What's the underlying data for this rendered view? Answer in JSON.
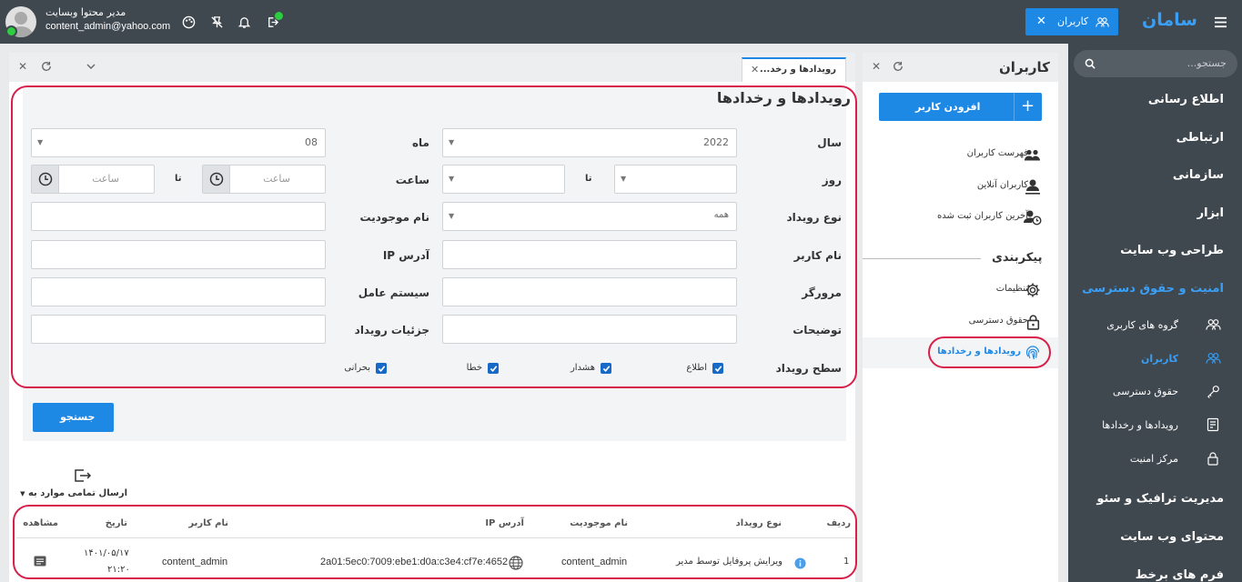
{
  "topbar": {
    "user_name": "مدیر محتوا وبسایت",
    "user_email": "content_admin@yahoo.com",
    "app_name": "سامان",
    "active_chip": "کاربران"
  },
  "sidebar": {
    "search_placeholder": "جستجو...",
    "items": [
      {
        "label": "اطلاع رسانی"
      },
      {
        "label": "ارتباطی"
      },
      {
        "label": "سازمانی"
      },
      {
        "label": "ابزار"
      },
      {
        "label": "طراحی وب سایت"
      },
      {
        "label": "امنیت و حقوق دسترسی"
      },
      {
        "label": "مدیریت ترافیک و سئو"
      },
      {
        "label": "محتوای وب سایت"
      },
      {
        "label": "فرم های برخط"
      }
    ],
    "sub_items": [
      {
        "label": "گروه های کاربری",
        "icon": "users-group-icon"
      },
      {
        "label": "کاربران",
        "icon": "users-icon"
      },
      {
        "label": "حقوق دسترسی",
        "icon": "key-icon"
      },
      {
        "label": "رویدادها و رخدادها",
        "icon": "event-list-icon"
      },
      {
        "label": "مرکز امنیت",
        "icon": "lock-icon"
      }
    ]
  },
  "users_panel": {
    "title": "کاربران",
    "add_button": "افزودن کاربر",
    "items": [
      {
        "label": "فهرست کاربران"
      },
      {
        "label": "کاربران آنلاین"
      },
      {
        "label": "آخرین کاربران ثبت شده"
      }
    ],
    "section_title": "پیکربندی",
    "config_items": [
      {
        "label": "تنظیمات"
      },
      {
        "label": "حقوق دسترسی"
      },
      {
        "label": "رویدادها و رخدادها"
      }
    ]
  },
  "main_panel": {
    "tab_label": "رویدادها و رخد...",
    "title": "رویدادها و رخدادها",
    "form": {
      "year_label": "سال",
      "year_value": "2022",
      "month_label": "ماه",
      "month_value": "08",
      "day_label": "روز",
      "to_label": "تا",
      "hour_label": "ساعت",
      "hour_placeholder": "ساعت",
      "event_type_label": "نوع رویداد",
      "event_type_value": "همه",
      "entity_name_label": "نام موجودیت",
      "username_label": "نام کاربر",
      "ip_label": "آدرس IP",
      "browser_label": "مرورگر",
      "os_label": "سیستم عامل",
      "description_label": "توضیحات",
      "event_details_label": "جزئیات رویداد",
      "level_label": "سطح رویداد",
      "levels": [
        "اطلاع",
        "هشدار",
        "خطا",
        "بحرانی"
      ]
    },
    "search_button": "جستجو",
    "export_label": "ارسال تمامی موارد به",
    "table": {
      "headers": [
        "ردیف",
        "نوع رویداد",
        "نام موجودیت",
        "آدرس IP",
        "نام کاربر",
        "تاریخ",
        "مشاهده"
      ],
      "rows": [
        {
          "index": "1",
          "event_type": "ویرایش پروفایل توسط مدیر",
          "entity_name": "content_admin",
          "ip": "2a01:5ec0:7009:ebe1:d0a:c3e4:cf7e:4652",
          "username": "content_admin",
          "date": "۱۴۰۱/۰۵/۱۷",
          "time": "۲۱:۲۰"
        }
      ]
    }
  },
  "colors": {
    "topbar": "#3f474f",
    "accent": "#1e88e5",
    "highlight": "#d81f4a",
    "online": "#2ecc40"
  }
}
